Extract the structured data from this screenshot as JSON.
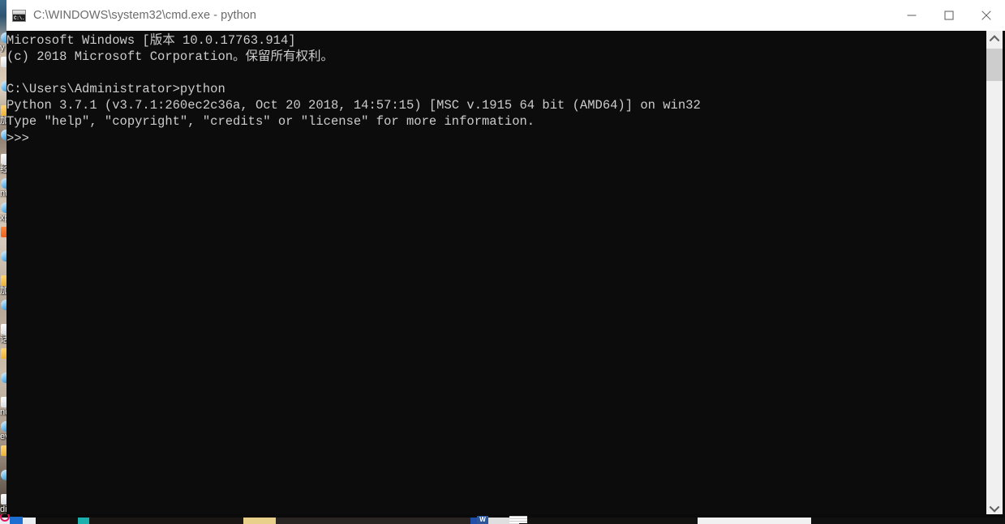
{
  "window": {
    "title": "C:\\WINDOWS\\system32\\cmd.exe - python",
    "icon": "cmd-console-icon",
    "icon_text": "C:\\.",
    "titlebar_bg": "#ffffff",
    "title_color": "#6b6b6b",
    "controls": {
      "minimize_label": "—",
      "minimize_name": "minimize-button",
      "maximize_label": "□",
      "maximize_name": "maximize-button",
      "close_label": "✕",
      "close_name": "close-button"
    }
  },
  "console": {
    "background": "#0c0c0c",
    "foreground": "#cccccc",
    "lines": [
      "Microsoft Windows [版本 10.0.17763.914]",
      "(c) 2018 Microsoft Corporation。保留所有权利。",
      "",
      "C:\\Users\\Administrator>python",
      "Python 3.7.1 (v3.7.1:260ec2c36a, Oct 20 2018, 14:57:15) [MSC v.1915 64 bit (AMD64)] on win32",
      "Type \"help\", \"copyright\", \"credits\" or \"license\" for more information.",
      ">>>"
    ]
  },
  "scrollbar": {
    "track_color": "#f0f0f0",
    "thumb_color": "#cdcdcd",
    "up_arrow": "chevron-up-icon",
    "down_arrow": "chevron-down-icon"
  },
  "desktop": {
    "wallpaper_description": "photo-wallpaper",
    "icons": [
      {
        "label": "y",
        "glyph": "ie"
      },
      {
        "label": "",
        "glyph": "white"
      },
      {
        "label": "",
        "glyph": "ie"
      },
      {
        "label": "加",
        "glyph": "folder"
      },
      {
        "label": "",
        "glyph": "ie"
      },
      {
        "label": "经",
        "glyph": "white"
      },
      {
        "label": "nt",
        "glyph": "ie"
      },
      {
        "label": "xp",
        "glyph": "ie"
      },
      {
        "label": "",
        "glyph": "orange"
      },
      {
        "label": "",
        "glyph": "ie"
      },
      {
        "label": "加",
        "glyph": "folder"
      },
      {
        "label": "",
        "glyph": "ie"
      },
      {
        "label": "话",
        "glyph": "white"
      },
      {
        "label": "",
        "glyph": "folder"
      },
      {
        "label": "",
        "glyph": "ie"
      },
      {
        "label": "nc",
        "glyph": "white"
      },
      {
        "label": "ev",
        "glyph": "ie"
      },
      {
        "label": "",
        "glyph": "folder"
      },
      {
        "label": "",
        "glyph": "ie"
      },
      {
        "label": "di",
        "glyph": "white"
      }
    ]
  },
  "taskbar": {
    "word_icon_label": "W",
    "background": "#0a0a0a"
  }
}
